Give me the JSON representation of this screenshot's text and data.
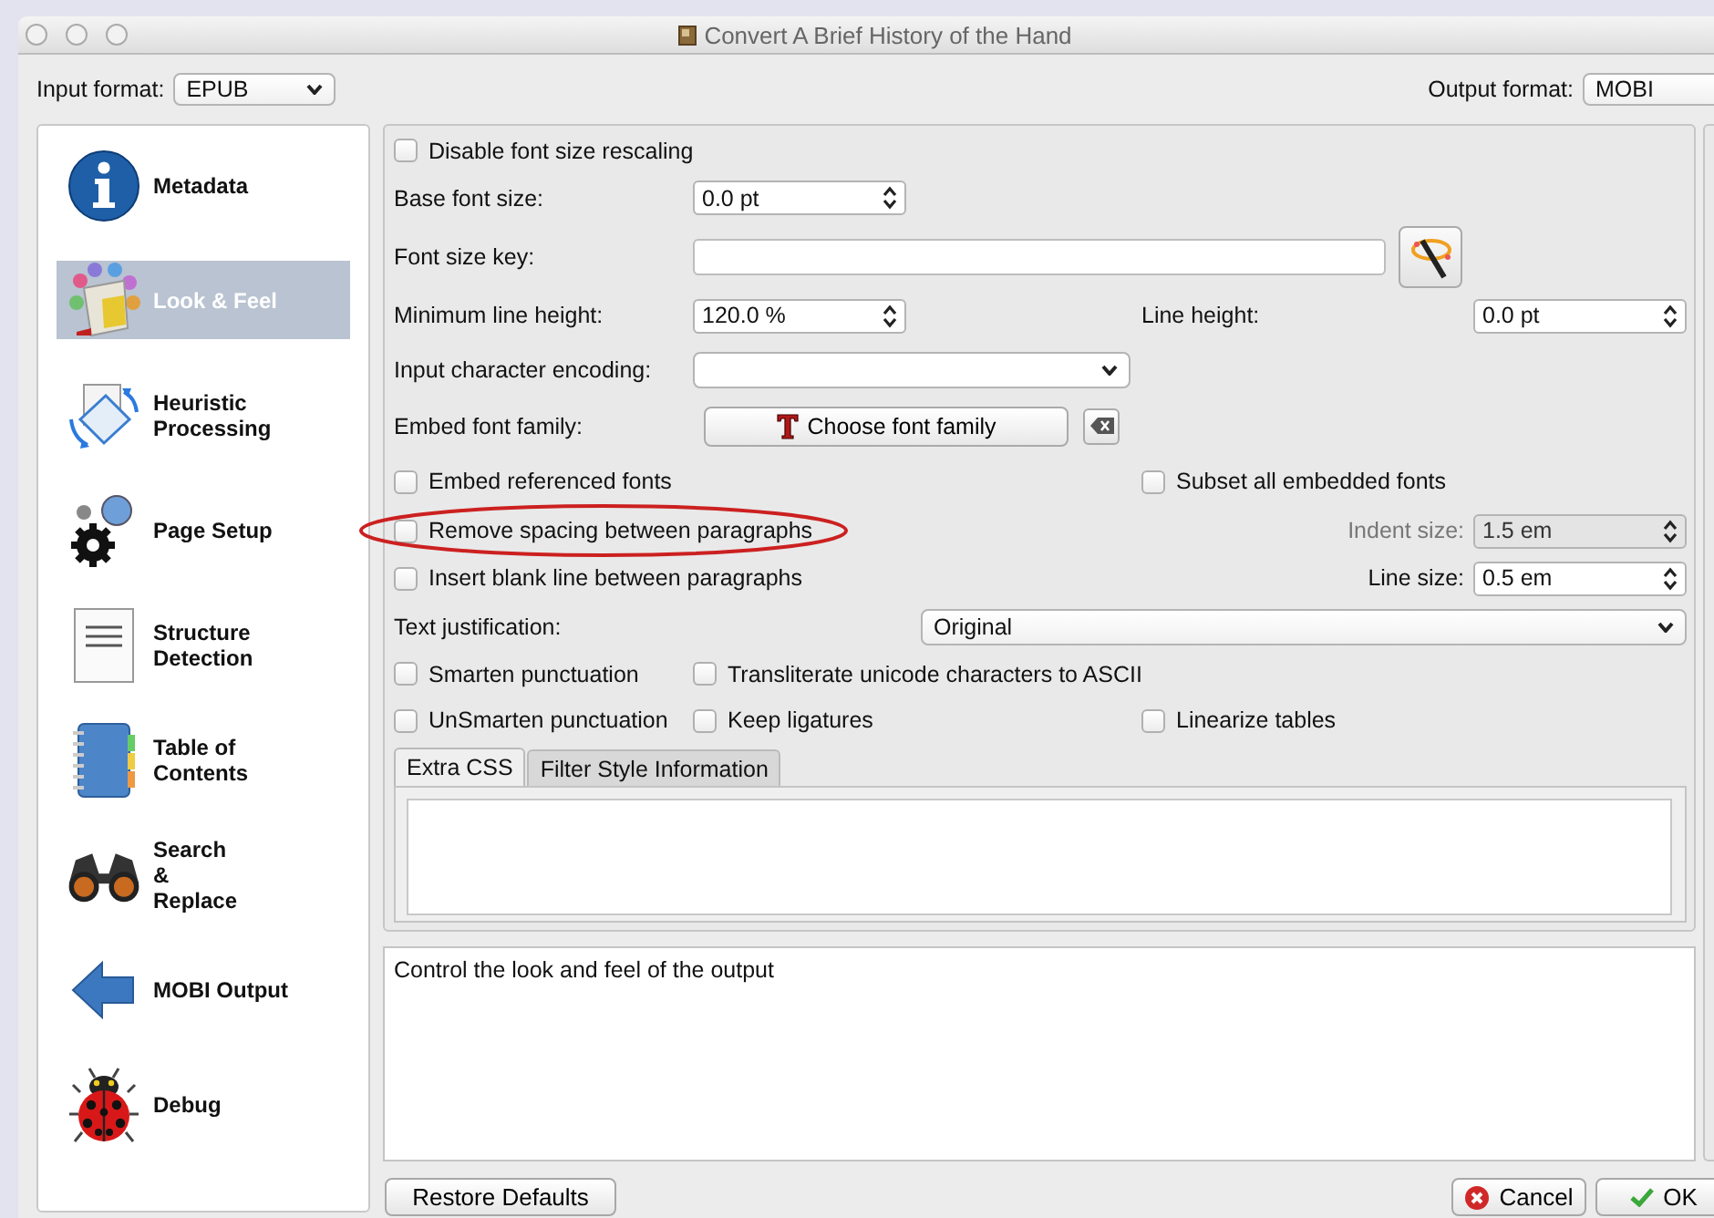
{
  "window": {
    "title": "Convert A Brief History of the Hand"
  },
  "input_format": {
    "label": "Input format:",
    "value": "EPUB"
  },
  "output_format": {
    "label": "Output format:",
    "value": "MOBI"
  },
  "sidebar": {
    "items": [
      {
        "kind": "metadata",
        "label": "Metadata",
        "selected": false
      },
      {
        "kind": "look_feel",
        "label": "Look & Feel",
        "selected": true
      },
      {
        "kind": "heuristic",
        "label": "Heuristic\nProcessing",
        "selected": false
      },
      {
        "kind": "page_setup",
        "label": "Page Setup",
        "selected": false
      },
      {
        "kind": "structure",
        "label": "Structure\nDetection",
        "selected": false
      },
      {
        "kind": "toc",
        "label": "Table of\nContents",
        "selected": false
      },
      {
        "kind": "search",
        "label": "Search\n&\nReplace",
        "selected": false
      },
      {
        "kind": "output",
        "label": "MOBI Output",
        "selected": false
      },
      {
        "kind": "debug",
        "label": "Debug",
        "selected": false
      }
    ]
  },
  "look_and_feel": {
    "disable_font_size_rescaling": {
      "label": "Disable font size rescaling",
      "checked": false,
      "highlighted": false
    },
    "base_font_size": {
      "label": "Base font size:",
      "value": "0.0 pt"
    },
    "font_size_key": {
      "label": "Font size key:"
    },
    "minimum_line_height": {
      "label": "Minimum line height:",
      "value": "120.0 %"
    },
    "line_height": {
      "label": "Line height:",
      "value": "0.0 pt"
    },
    "input_character_encoding": {
      "label": "Input character encoding:"
    },
    "embed_font_family": {
      "label": "Embed font family:",
      "button": "Choose font family"
    },
    "embed_referenced_fonts": {
      "label": "Embed referenced fonts",
      "checked": false,
      "highlighted": false
    },
    "subset_all_embedded_fonts": {
      "label": "Subset all embedded fonts",
      "checked": false,
      "highlighted": false
    },
    "remove_spacing": {
      "label": "Remove spacing between paragraphs",
      "checked": false,
      "highlighted": true
    },
    "indent_size": {
      "label": "Indent size:",
      "value": "1.5 em",
      "disabled": true
    },
    "insert_blank_line": {
      "label": "Insert blank line between paragraphs",
      "checked": false,
      "highlighted": false
    },
    "line_size": {
      "label": "Line size:",
      "value": "0.5 em",
      "disabled": false
    },
    "text_justification": {
      "label": "Text justification:",
      "value": "Original"
    },
    "smarten_punctuation": {
      "label": "Smarten punctuation",
      "checked": false,
      "highlighted": false
    },
    "transliterate": {
      "label": "Transliterate unicode characters to ASCII",
      "checked": false,
      "highlighted": false
    },
    "unsmarten_punctuation": {
      "label": "UnSmarten punctuation",
      "checked": false,
      "highlighted": false
    },
    "keep_ligatures": {
      "label": "Keep ligatures",
      "checked": false,
      "highlighted": false
    },
    "linearize_tables": {
      "label": "Linearize tables",
      "checked": false,
      "highlighted": false
    },
    "tabs": [
      {
        "label": "Extra CSS",
        "selected": true
      },
      {
        "label": "Filter Style Information",
        "selected": false
      }
    ]
  },
  "description": "Control the look and feel of the output",
  "buttons": {
    "restore": "Restore Defaults",
    "cancel": "Cancel",
    "ok": "OK"
  }
}
